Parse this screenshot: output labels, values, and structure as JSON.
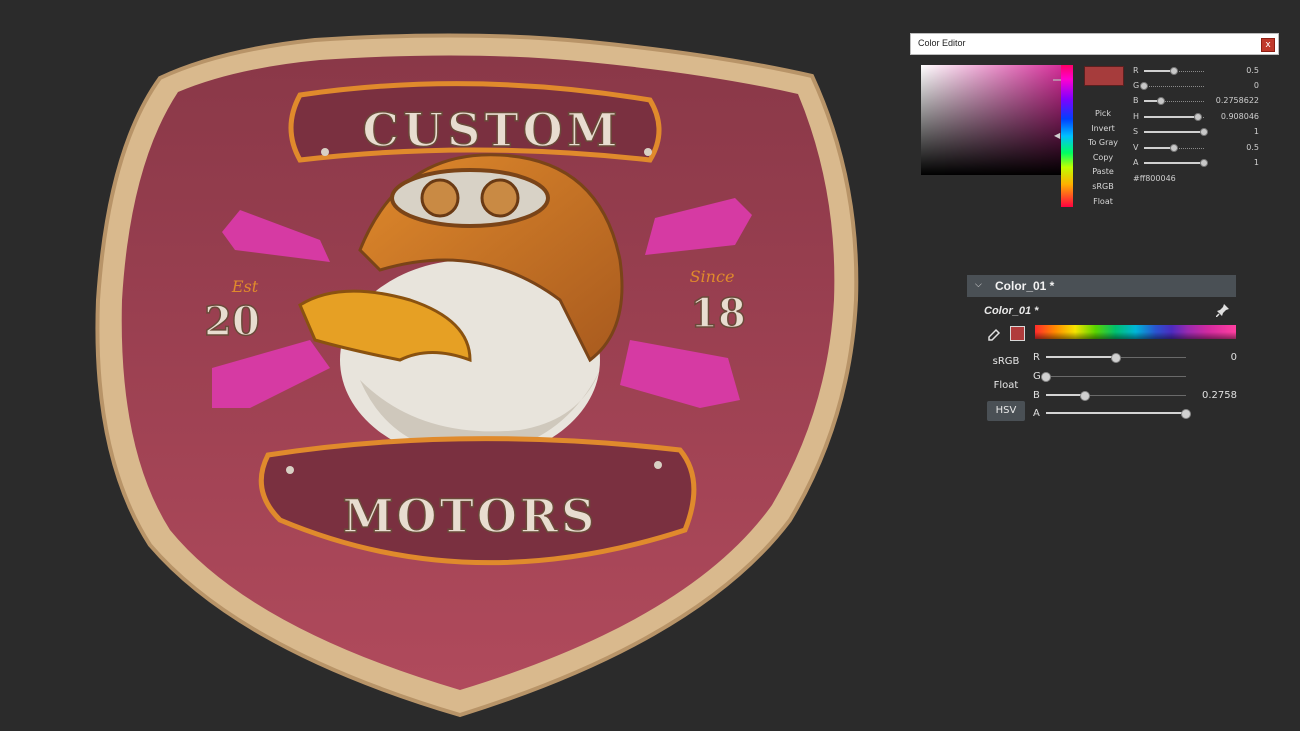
{
  "patch": {
    "top_text": "CUSTOM",
    "bottom_text": "MOTORS",
    "year_left": "20",
    "year_right": "18",
    "script_left": "Est",
    "script_right": "Since"
  },
  "color_editor": {
    "title": "Color Editor",
    "close_label": "x",
    "hex": "#ff800046",
    "actions": [
      "Pick",
      "Invert",
      "To Gray",
      "Copy",
      "Paste",
      "sRGB",
      "Float"
    ],
    "channels": [
      {
        "label": "R",
        "value": "0.5",
        "fraction": 0.5
      },
      {
        "label": "G",
        "value": "0",
        "fraction": 0.0
      },
      {
        "label": "B",
        "value": "0.2758622",
        "fraction": 0.2758622
      },
      {
        "label": "H",
        "value": "0.908046",
        "fraction": 0.908046
      },
      {
        "label": "S",
        "value": "1",
        "fraction": 1.0
      },
      {
        "label": "V",
        "value": "0.5",
        "fraction": 0.5
      },
      {
        "label": "A",
        "value": "1",
        "fraction": 1.0
      }
    ],
    "swatch_color": "#a63c3c"
  },
  "color_panel": {
    "header_title": "Color_01 *",
    "name": "Color_01 *",
    "modes": {
      "srgb": "sRGB",
      "float": "Float",
      "hsv": "HSV"
    },
    "channels": [
      {
        "label": "R",
        "value": "0",
        "fraction": 0.5
      },
      {
        "label": "G",
        "value": "",
        "fraction": 0.0
      },
      {
        "label": "B",
        "value": "0.2758",
        "fraction": 0.2758
      },
      {
        "label": "A",
        "value": "",
        "fraction": 1.0
      }
    ],
    "swatch_color": "#b03b3b"
  }
}
